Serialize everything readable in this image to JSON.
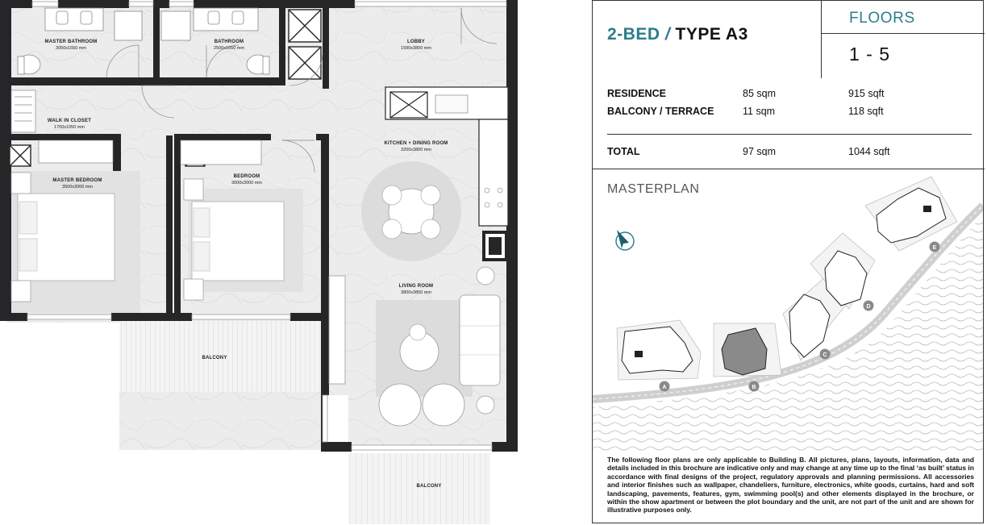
{
  "floorplan": {
    "rooms": {
      "master_bathroom": {
        "name": "MASTER BATHROOM",
        "size": "3050x1550 mm"
      },
      "bathroom": {
        "name": "BATHROOM",
        "size": "2500x1650 mm"
      },
      "lobby": {
        "name": "LOBBY",
        "size": "1590x3800 mm"
      },
      "walk_in_closet": {
        "name": "WALK IN CLOSET",
        "size": "1700x1050 mm"
      },
      "kitchen_dining": {
        "name": "KITCHEN + DINING ROOM",
        "size": "3200x3800 mm"
      },
      "master_bedroom": {
        "name": "MASTER BEDROOM",
        "size": "3500x3000 mm"
      },
      "bedroom": {
        "name": "BEDROOM",
        "size": "3000x3000 mm"
      },
      "living_room": {
        "name": "LIVING ROOM",
        "size": "3800x3850 mm"
      },
      "balcony_1": {
        "name": "BALCONY"
      },
      "balcony_2": {
        "name": "BALCONY"
      }
    }
  },
  "header": {
    "title_accent": "2-BED",
    "title_sep": " / ",
    "title_main": "TYPE A3",
    "floors_label": "FLOORS",
    "floors_value": "1 - 5"
  },
  "areas": [
    {
      "label": "RESIDENCE",
      "sqm": "85 sqm",
      "sqft": "915 sqft"
    },
    {
      "label": "BALCONY / TERRACE",
      "sqm": "11 sqm",
      "sqft": "118 sqft"
    }
  ],
  "total": {
    "label": "TOTAL",
    "sqm": "97 sqm",
    "sqft": "1044 sqft"
  },
  "masterplan": {
    "title": "MASTERPLAN",
    "buildings": [
      "A",
      "B",
      "C",
      "D",
      "E"
    ],
    "highlighted": "B"
  },
  "colors": {
    "accent": "#2c7d8c",
    "wall": "#262628",
    "floor": "#ececec",
    "highlight": "#8a8a8a"
  },
  "disclaimer": "The following floor plans are only applicable to Building B. All pictures, plans, layouts, information, data and details included in this brochure are indicative only and may change at any time up to the final ‘as built’ status in accordance with final designs of the project, regulatory approvals and planning permissions. All accessories and interior finishes such as wallpaper, chandeliers, furniture, electronics, white goods, curtains, hard and soft landscaping, pavements, features, gym, swimming pool(s) and other elements displayed in the brochure, or within the show apartment or between the plot boundary and the unit, are not part of the unit and are shown for illustrative purposes only."
}
